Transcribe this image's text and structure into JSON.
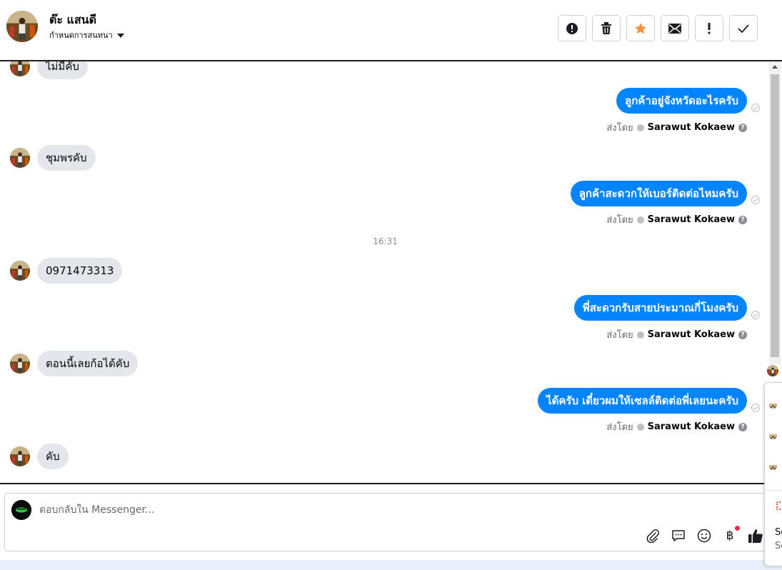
{
  "header": {
    "contact_name": "ต๊ะ แสนดี",
    "conversation_settings": "กำหนดการสนทนา",
    "actions": [
      {
        "name": "report-button",
        "icon": "exclamation-circle-icon"
      },
      {
        "name": "delete-button",
        "icon": "trash-icon"
      },
      {
        "name": "star-button",
        "icon": "star-icon",
        "color": "#f7923a"
      },
      {
        "name": "mark-unread-button",
        "icon": "envelope-icon"
      },
      {
        "name": "follow-up-button",
        "icon": "exclamation-icon"
      },
      {
        "name": "mark-done-button",
        "icon": "check-icon"
      }
    ]
  },
  "messages": {
    "m0": "ไม่มีคับ",
    "m1": "ลูกค้าอยู่จังหวัดอะไรครับ",
    "m2": "ชุมพรคับ",
    "m3": "ลูกค้าสะดวกให้เบอร์ติดต่อไหมครับ",
    "time": "16:31",
    "m4": "0971473313",
    "m5": "พี่สะดวกรับสายประมาณกี่โมงครับ",
    "m6": "ตอนนี้เลยก้อได้คับ",
    "m7": "ได้ครับ เดี๋ยวผมให้เซลล์ติดต่อพี่เลยนะครับ",
    "m8": "คับ"
  },
  "sent_by": {
    "label": "ส่งโดย",
    "sender": "Sarawut Kokaew",
    "help": "?"
  },
  "composer": {
    "placeholder": "ตอบกลับใน Messenger...",
    "currency_symbol": "฿"
  },
  "side_panel": {
    "text_1": "Se",
    "text_2": "Se"
  },
  "colors": {
    "outgoing_bubble": "#0084ff",
    "incoming_bubble": "#e4e6eb",
    "star": "#f7923a",
    "notification": "#f02849"
  }
}
